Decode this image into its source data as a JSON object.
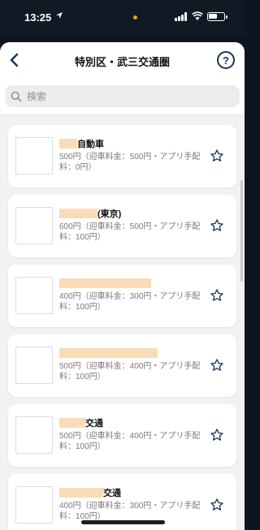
{
  "status_bar": {
    "time": "13:25",
    "location_icon": "location-arrow-icon",
    "colors": {
      "dot": "#f29b2c"
    }
  },
  "header": {
    "title": "特別区・武三交通圏",
    "back_icon": "chevron-left-icon",
    "help_label": "?"
  },
  "search": {
    "placeholder": "検索"
  },
  "companies": [
    {
      "name": "自動車",
      "price": "500円（迎車料金：500円・アプリ手配料：0円）"
    },
    {
      "name": "(東京)",
      "price": "600円（迎車料金：500円・アプリ手配料：100円）"
    },
    {
      "name": "",
      "price": "400円（迎車料金：300円・アプリ手配料：100円）"
    },
    {
      "name": "",
      "price": "500円（迎車料金：400円・アプリ手配料：100円）"
    },
    {
      "name": "交通",
      "price": "500円（迎車料金：400円・アプリ手配料：100円）"
    },
    {
      "name": "交通",
      "price": "400円（迎車料金：300円・アプリ手配料：100円）"
    }
  ],
  "colors": {
    "accent": "#16345a",
    "redaction": "#f8dcb7"
  }
}
